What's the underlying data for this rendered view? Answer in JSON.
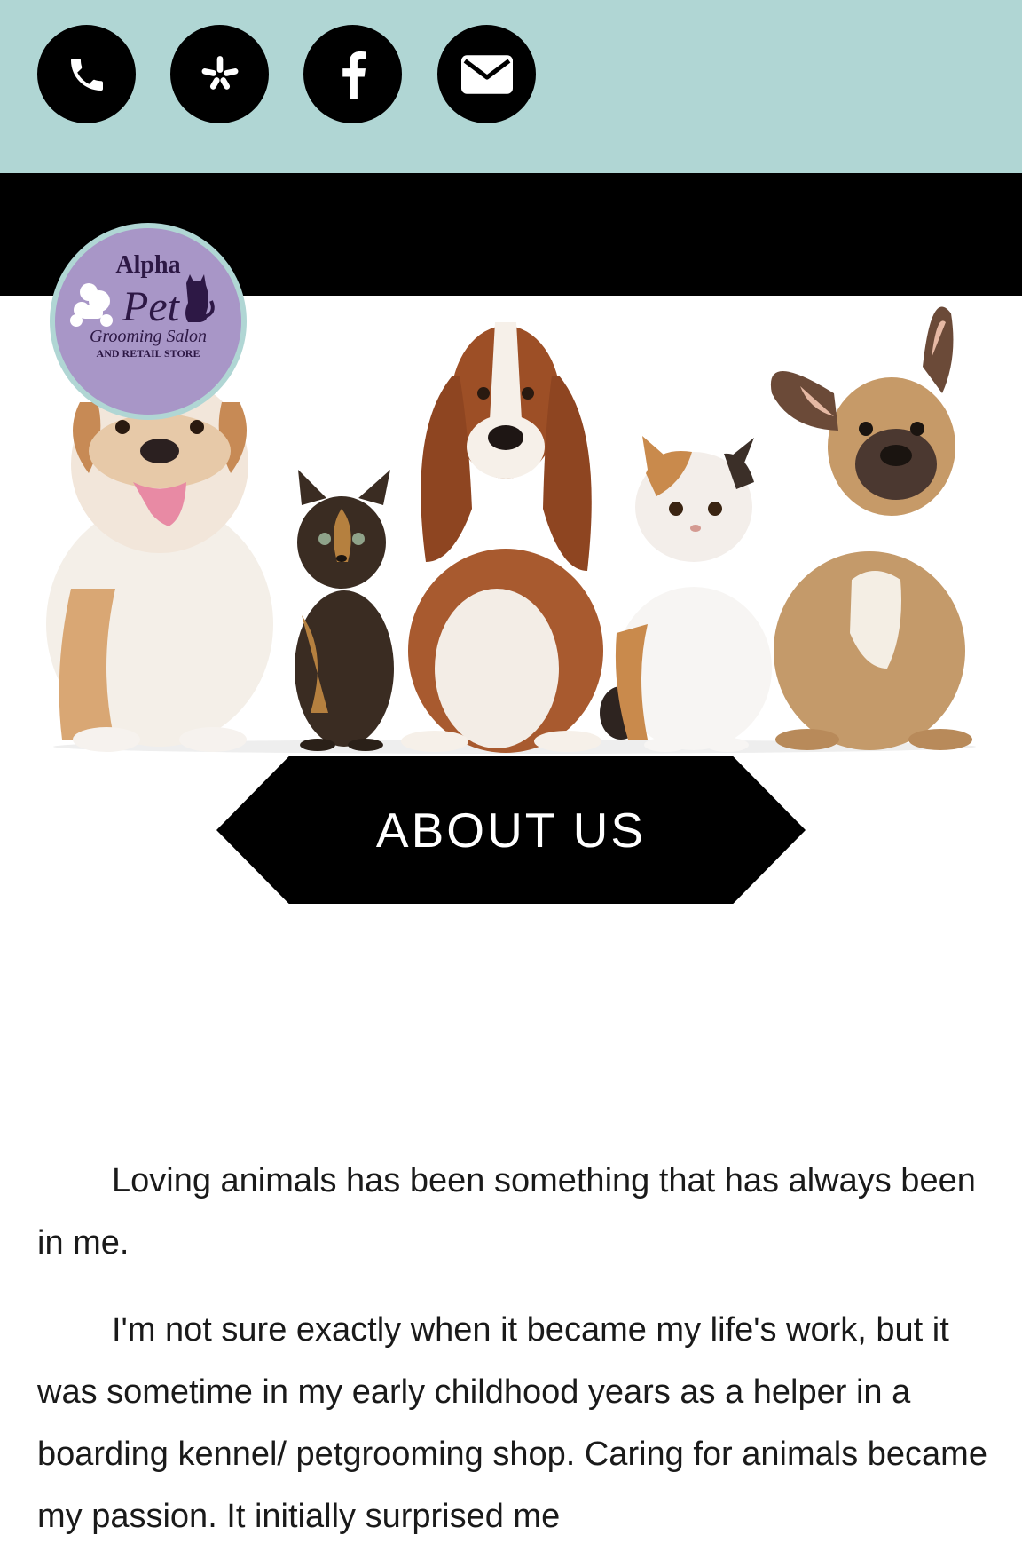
{
  "social": {
    "items": [
      {
        "name": "phone",
        "icon": "phone-icon"
      },
      {
        "name": "yelp",
        "icon": "yelp-icon"
      },
      {
        "name": "facebook",
        "icon": "facebook-icon"
      },
      {
        "name": "email",
        "icon": "envelope-icon"
      }
    ]
  },
  "logo": {
    "line1": "Alpha",
    "line2": "Pet",
    "line3": "Grooming Salon",
    "line4": "AND RETAIL STORE"
  },
  "banner": {
    "title": "ABOUT US"
  },
  "about": {
    "paragraphs": [
      "Loving animals has been something that has always been in me.",
      "I'm not sure exactly when it became my life's work, but it was sometime in my early childhood years as a helper in a boarding kennel/ petgrooming shop. Caring for animals became my passion. It initially surprised me"
    ]
  },
  "colors": {
    "topbar": "#b0d6d4",
    "black": "#000000",
    "logo_purple": "#a896c7",
    "logo_text": "#2d1845"
  }
}
